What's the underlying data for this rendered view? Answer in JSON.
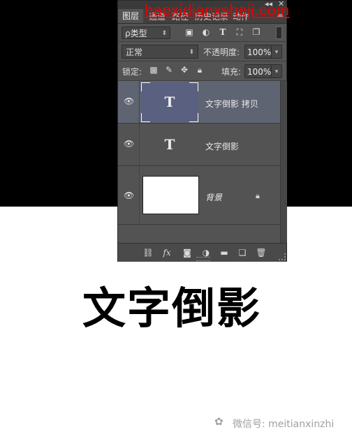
{
  "panel": {
    "tabs": [
      {
        "label": "图层",
        "active": true
      },
      {
        "label": "通道",
        "active": false
      },
      {
        "label": "路径",
        "active": false
      },
      {
        "label": "历史记录",
        "active": false
      },
      {
        "label": "动作",
        "active": false
      }
    ],
    "top_controls": {
      "collapse": "◂◂",
      "close": "✕"
    },
    "menu_icon": "≡",
    "filter": {
      "label": "ρ类型",
      "icons": [
        "image-filter-icon",
        "adjustment-filter-icon",
        "type-filter-icon",
        "shape-filter-icon",
        "smart-object-filter-icon"
      ]
    },
    "blend_mode": "正常",
    "opacity_label": "不透明度:",
    "opacity_value": "100%",
    "lock_label": "锁定:",
    "fill_label": "填充:",
    "fill_value": "100%",
    "layers": [
      {
        "name": "文字倒影 拷贝",
        "type": "text",
        "thumb_glyph": "T",
        "selected": true,
        "visible": true
      },
      {
        "name": "文字倒影",
        "type": "text",
        "thumb_glyph": "T",
        "selected": false,
        "visible": true
      },
      {
        "name": "背景",
        "type": "background",
        "selected": false,
        "visible": true,
        "locked": true
      }
    ],
    "bottom_icons": [
      "link-icon",
      "fx-icon",
      "mask-icon",
      "adjustment-icon",
      "folder-icon",
      "new-layer-icon",
      "trash-icon"
    ],
    "fx_label": "fx"
  },
  "watermark_top": "haoxidianxsheji.com",
  "canvas_text": "文字倒影",
  "footer": {
    "wechat_label": "微信号: meitianxinzhi"
  },
  "colors": {
    "selected_layer": "#5f6472",
    "panel_bg": "#535353",
    "watermark": "#e60000"
  }
}
